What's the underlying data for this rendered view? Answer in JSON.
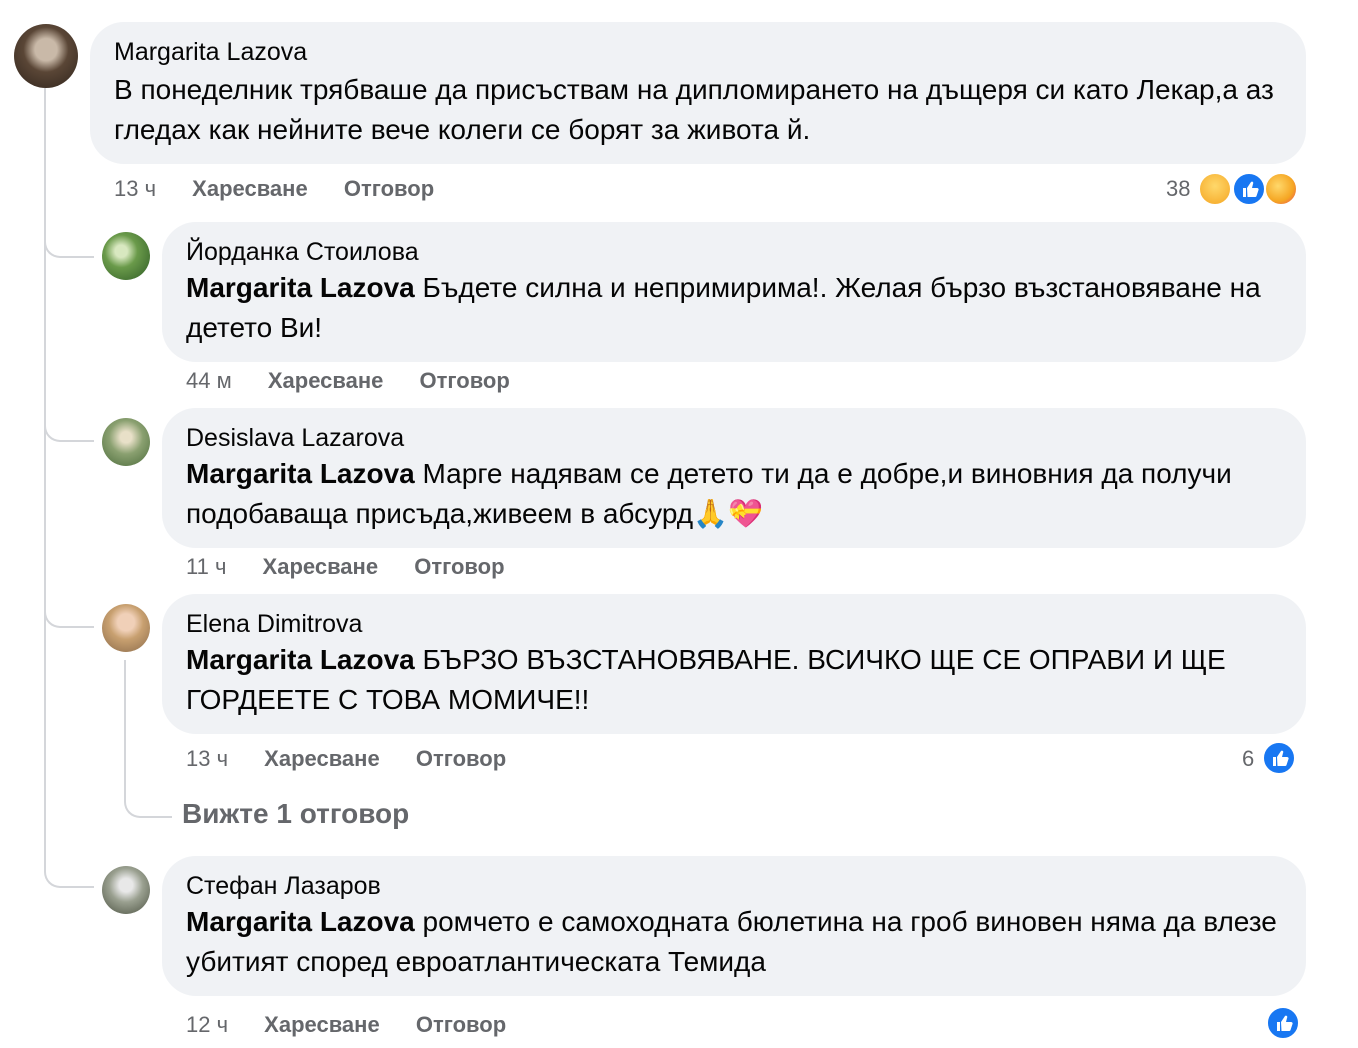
{
  "comments": [
    {
      "author": "Margarita Lazova",
      "tag": "",
      "text": "В понеделник трябваше да присъствам на дипломирането на дъщеря си като Лекар,а аз гледах как нейните вече колеги се борят за живота й.",
      "time": "13 ч",
      "like": "Харесване",
      "reply": "Отговор",
      "reactions": "38",
      "reaction_icons": [
        "sad-face-icon",
        "like-icon",
        "care-icon"
      ]
    },
    {
      "author": "Йорданка Стоилова",
      "tag": "Margarita Lazova",
      "text": "Бъдете силна и непримирима!. Желая бързо възстановяване на детето Ви!",
      "time": "44 м",
      "like": "Харесване",
      "reply": "Отговор",
      "reactions": ""
    },
    {
      "author": "Desislava Lazarova",
      "tag": "Margarita Lazova",
      "text": "Марге надявам се детето ти да е добре,и виновния да получи подобаваща присъда,живеем в абсурд🙏💝",
      "time": "11 ч",
      "like": "Харесване",
      "reply": "Отговор",
      "reactions": ""
    },
    {
      "author": "Elena Dimitrova",
      "tag": "Margarita Lazova",
      "text": "БЪРЗО ВЪЗСТАНОВЯВАНЕ. ВСИЧКО ЩЕ СЕ ОПРАВИ И ЩЕ ГОРДЕЕТЕ С ТОВА МОМИЧЕ!!",
      "time": "13 ч",
      "like": "Харесване",
      "reply": "Отговор",
      "reactions": "6",
      "view_replies": "Вижте 1 отговор"
    },
    {
      "author": "Стефан Лазаров",
      "tag": "Margarita Lazova",
      "text": "ромчето е самоходната бюлетина на гроб виновен няма да влезе убитият според евроатлантическата Темида",
      "time": "12 ч",
      "like": "Харесване",
      "reply": "Отговор",
      "reactions": ""
    }
  ],
  "colors": {
    "bubble": "#f0f2f5",
    "meta": "#65676b",
    "like_blue": "#1877f2"
  }
}
